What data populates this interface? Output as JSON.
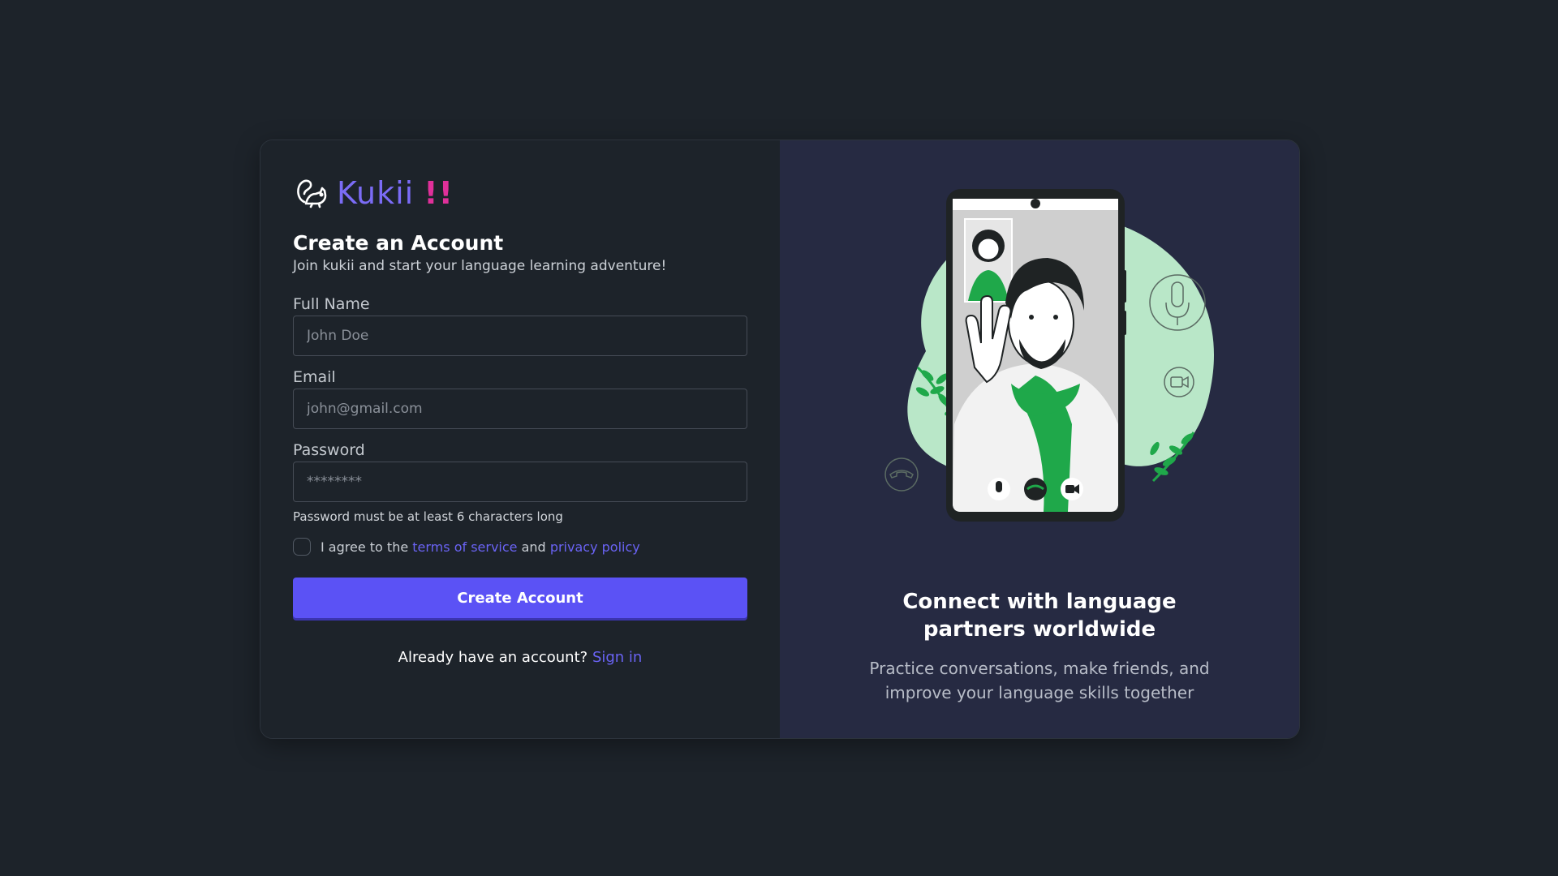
{
  "brand": {
    "name": "Kukii",
    "bang": "!!",
    "icon": "squirrel-icon"
  },
  "form": {
    "title": "Create an Account",
    "subtitle": "Join kukii and start your language learning adventure!",
    "full_name": {
      "label": "Full Name",
      "placeholder": "John Doe",
      "value": ""
    },
    "email": {
      "label": "Email",
      "placeholder": "john@gmail.com",
      "value": ""
    },
    "password": {
      "label": "Password",
      "placeholder": "********",
      "value": "",
      "hint": "Password must be at least 6 characters long"
    },
    "agree": {
      "prefix": "I agree to the",
      "terms_link": "terms of service",
      "and": "and",
      "privacy_link": "privacy policy",
      "checked": false
    },
    "submit_label": "Create Account",
    "signin_prompt": "Already have an account?",
    "signin_link": "Sign in"
  },
  "promo": {
    "title": "Connect with language partners worldwide",
    "subtitle": "Practice conversations, make friends, and improve your language skills together",
    "illustration": "video-call-illustration"
  },
  "colors": {
    "background": "#1d232a",
    "panel": "#262a42",
    "accent": "#5b52f5",
    "brand": "#7b6cf6",
    "brand_bang": "#e0309a",
    "illustration_green": "#1fa84a"
  }
}
